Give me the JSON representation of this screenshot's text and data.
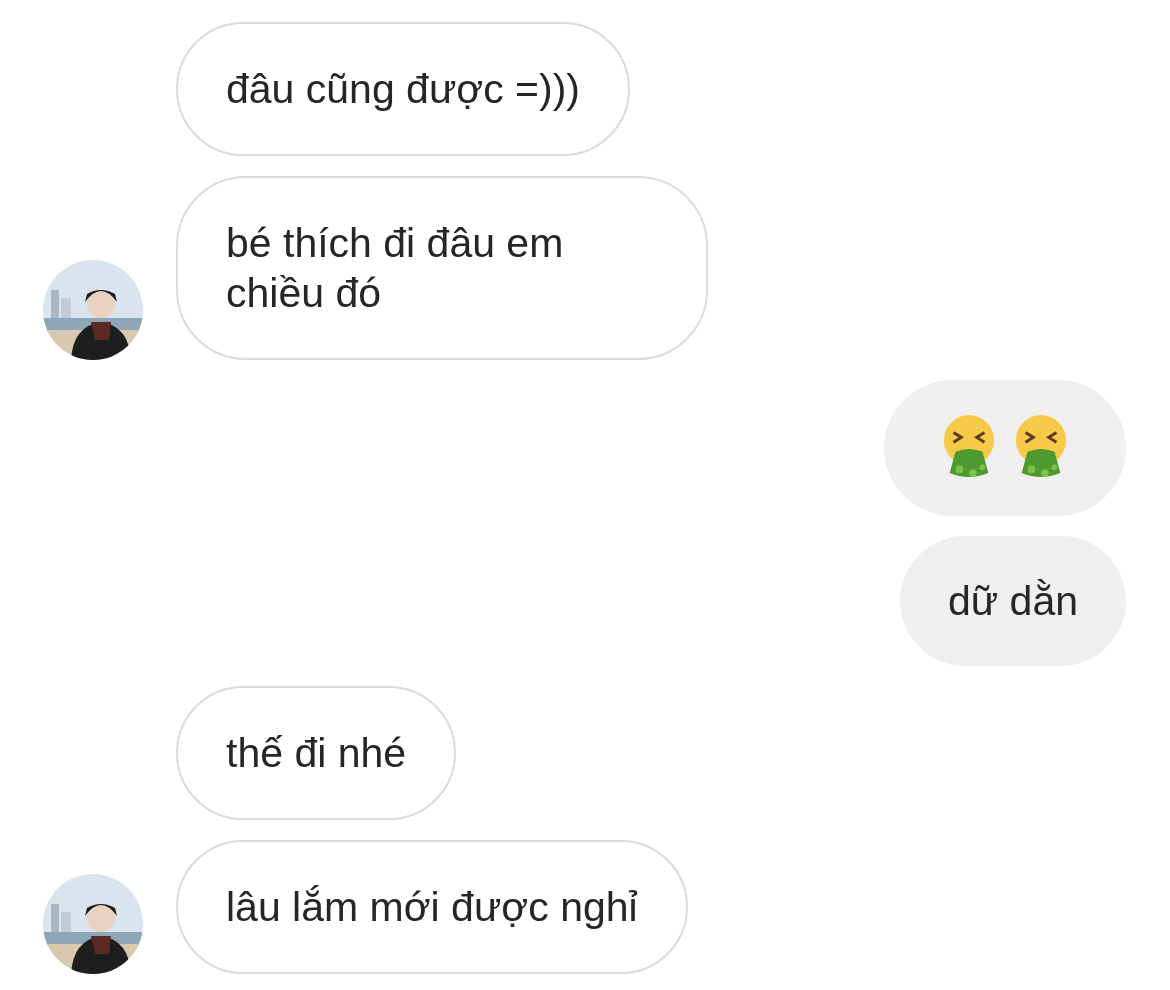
{
  "messages": [
    {
      "mine": false,
      "kind": "text",
      "text": "đâu cũng được =)))",
      "avatar": false
    },
    {
      "mine": false,
      "kind": "text",
      "text": "bé thích đi đâu em chiều đó",
      "avatar": true
    },
    {
      "mine": true,
      "kind": "emoji"
    },
    {
      "mine": true,
      "kind": "text",
      "text": "dữ dằn"
    },
    {
      "mine": false,
      "kind": "text",
      "text": "thế đi nhé",
      "avatar": false
    },
    {
      "mine": false,
      "kind": "text",
      "text": "lâu lắm mới được nghỉ",
      "avatar": true
    }
  ]
}
